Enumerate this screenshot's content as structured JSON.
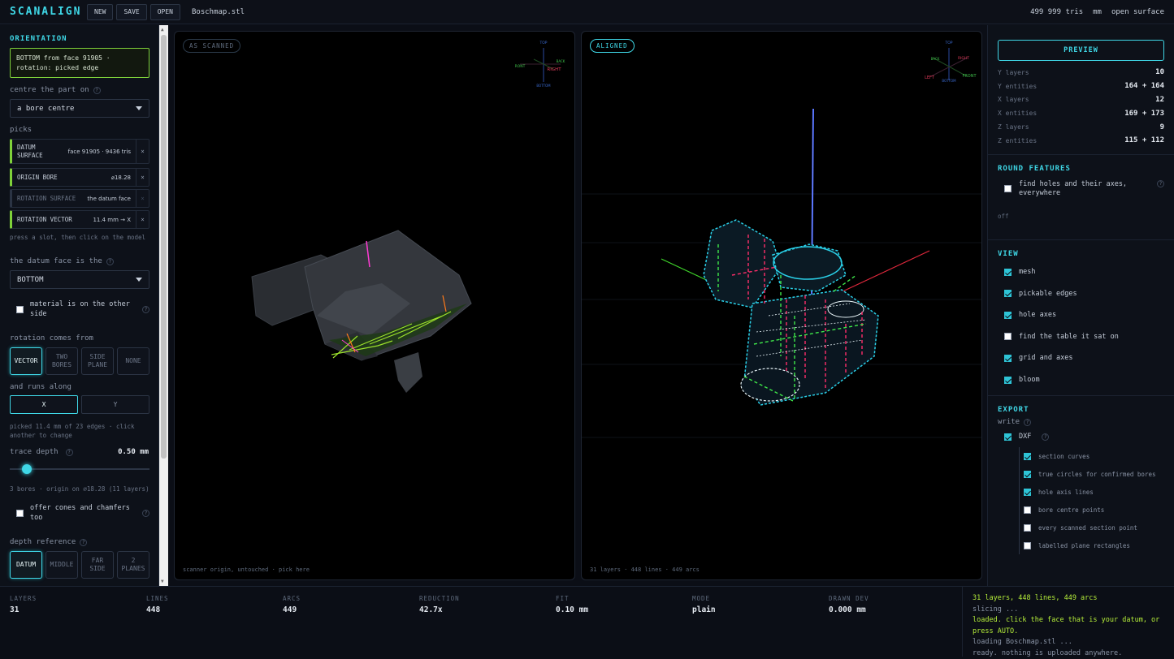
{
  "app": {
    "name": "SCANALIGN",
    "buttons": {
      "new": "NEW",
      "save": "SAVE",
      "open": "OPEN"
    },
    "file_name": "Boschmap.stl",
    "tris": "499 999 tris",
    "units": "mm",
    "surface": "open surface"
  },
  "left": {
    "title": "ORIENTATION",
    "status_line1": "BOTTOM from face 91905 ·",
    "status_line2": "rotation: picked edge",
    "centre_label": "centre the part on",
    "centre_value": "a bore centre",
    "picks_label": "picks",
    "picks": [
      {
        "name_line1": "DATUM",
        "name_line2": "SURFACE",
        "value": "face 91905 · 9436 tris",
        "close": "×"
      },
      {
        "name": "ORIGIN BORE",
        "value": "⌀18.28",
        "close": "×"
      },
      {
        "name": "ROTATION SURFACE",
        "value": "the datum face",
        "close": "×"
      },
      {
        "name": "ROTATION VECTOR",
        "value": "11.4 mm → X",
        "close": "×"
      }
    ],
    "picks_hint": "press a slot, then click on the model",
    "datum_label": "the datum face is the",
    "datum_value": "BOTTOM",
    "other_side": "material is on the other side",
    "rotation_label": "rotation comes from",
    "rotation_options": [
      "VECTOR",
      "TWO BORES",
      "SIDE PLANE",
      "NONE"
    ],
    "runs_label": "and runs along",
    "axis_options": [
      "X",
      "Y"
    ],
    "picked_hint": "picked 11.4 mm of 23 edges · click another to change",
    "trace_label": "trace depth",
    "trace_value": "0.50 mm",
    "trace_level": 0.12,
    "bores_hint": "3 bores · origin on ⌀18.28 (11 layers)",
    "cones": "offer cones and chamfers too",
    "depth_label": "depth reference",
    "depth_options": [
      "DATUM",
      "MIDDLE",
      "FAR SIDE",
      "2 PLANES"
    ]
  },
  "viewports": {
    "left_tag": "AS SCANNED",
    "left_foot": "scanner origin, untouched · pick here",
    "left_gizmo": {
      "top": "TOP",
      "front": "RONT",
      "back": "BACK",
      "right": "RIGHT",
      "bottom": "BOTTOM"
    },
    "right_tag": "ALIGNED",
    "right_foot": "31 layers · 448 lines · 449 arcs",
    "right_gizmo": {
      "top": "TOP",
      "back": "BACK",
      "left": "LEFT",
      "right": "RIGHT",
      "front": "FRONT",
      "bottom": "BOTTOM"
    }
  },
  "right": {
    "preview": "PREVIEW",
    "stats": [
      {
        "k": "Y layers",
        "v": "10"
      },
      {
        "k": "Y entities",
        "v": "164 + 164"
      },
      {
        "k": "X layers",
        "v": "12"
      },
      {
        "k": "X entities",
        "v": "169 + 173"
      },
      {
        "k": "Z layers",
        "v": "9"
      },
      {
        "k": "Z entities",
        "v": "115 + 112"
      }
    ],
    "round_title": "ROUND FEATURES",
    "round_opt": "find holes and their axes, everywhere",
    "round_state": "off",
    "view_title": "VIEW",
    "view_opts": [
      "mesh",
      "pickable edges",
      "hole axes",
      "find the table it sat on",
      "grid and axes",
      "bloom"
    ],
    "export_title": "EXPORT",
    "write_label": "write",
    "dxf": "DXF",
    "sub_opts": [
      "section curves",
      "true circles for confirmed bores",
      "hole axis lines",
      "bore centre points",
      "every scanned section point",
      "labelled plane rectangles"
    ]
  },
  "bottom": {
    "metrics": [
      {
        "k": "LAYERS",
        "v": "31"
      },
      {
        "k": "LINES",
        "v": "448"
      },
      {
        "k": "ARCS",
        "v": "449"
      },
      {
        "k": "REDUCTION",
        "v": "42.7x"
      },
      {
        "k": "FIT",
        "v": "0.10 mm"
      },
      {
        "k": "MODE",
        "v": "plain"
      },
      {
        "k": "DRAWN DEV",
        "v": "0.000 mm"
      }
    ],
    "log": [
      "31 layers, 448 lines, 449 arcs",
      "slicing ...",
      "loaded. click the face that is your datum, or press AUTO.",
      "loading Boschmap.stl ...",
      "ready. nothing is uploaded anywhere."
    ]
  },
  "colors": {
    "accent": "#3fd7e6",
    "pick": "#7fd23a",
    "log_green": "#b7f03a"
  }
}
